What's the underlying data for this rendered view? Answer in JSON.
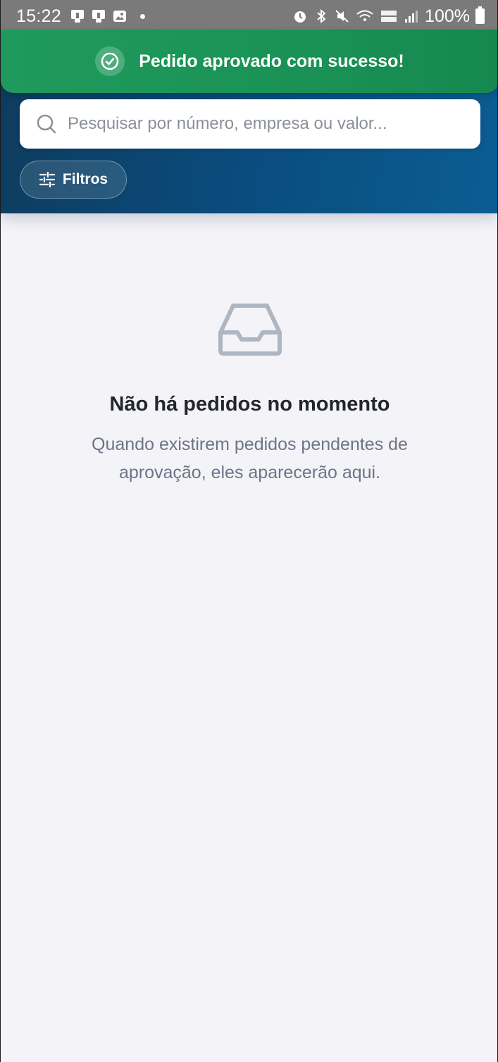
{
  "status_bar": {
    "time": "15:22",
    "battery": "100%"
  },
  "toast": {
    "message": "Pedido aprovado com sucesso!",
    "icon": "check-circle-icon",
    "color": "#1f9a5c"
  },
  "search": {
    "placeholder": "Pesquisar por número, empresa ou valor..."
  },
  "filters": {
    "label": "Filtros"
  },
  "empty_state": {
    "icon": "inbox-icon",
    "title": "Não há pedidos no momento",
    "description": "Quando existirem pedidos pendentes de aprovação, eles aparecerão aqui."
  },
  "colors": {
    "header_start": "#0e3b5d",
    "header_end": "#0b5d92",
    "background": "#f3f3f8"
  }
}
